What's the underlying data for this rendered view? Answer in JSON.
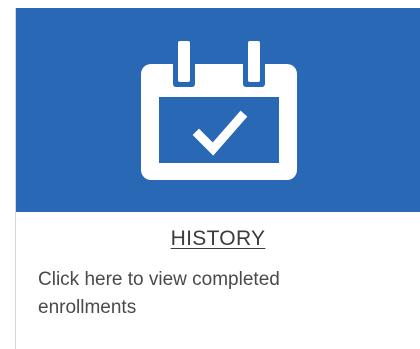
{
  "card": {
    "icon": "calendar-check-icon",
    "title": "HISTORY",
    "description": "Click here to view completed enrollments",
    "banner_color": "#2968b4"
  }
}
